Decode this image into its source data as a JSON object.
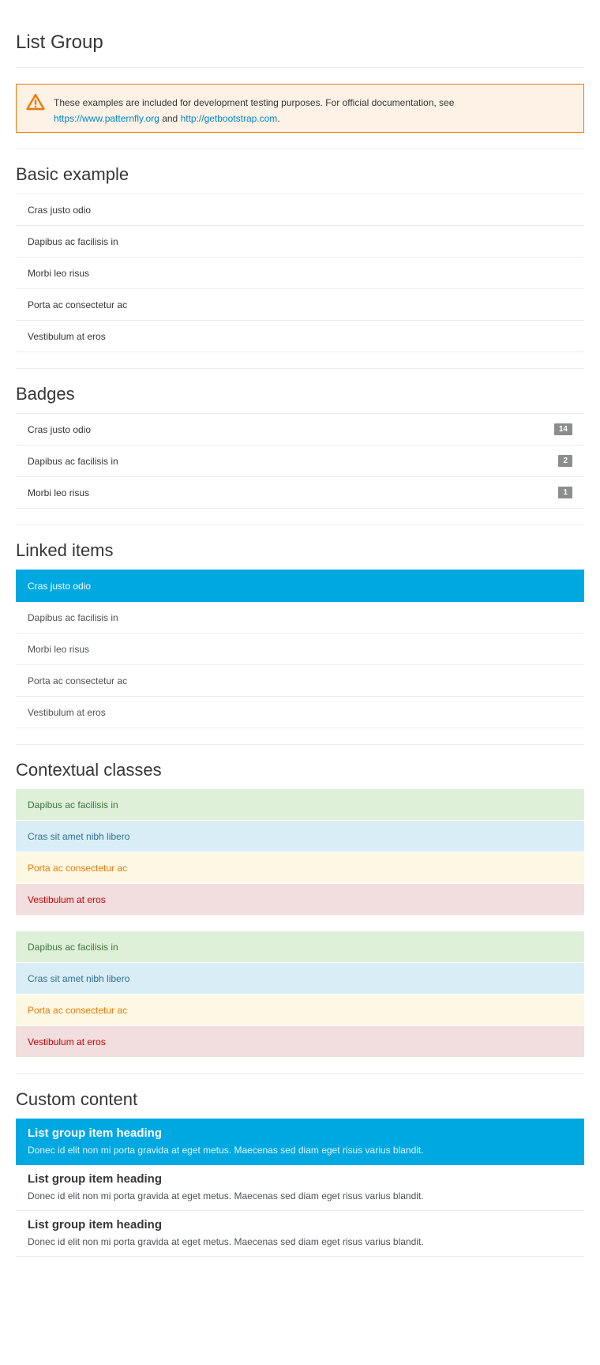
{
  "page": {
    "title": "List Group"
  },
  "alert": {
    "text_before": "These examples are included for development testing purposes. For official documentation, see",
    "link1": "https://www.patternfly.org",
    "text_and": "and",
    "link2": "http://getbootstrap.com",
    "text_end": ".",
    "icon": "warning-triangle-icon",
    "accent_color": "#ec7a08"
  },
  "basic": {
    "title": "Basic example",
    "items": [
      "Cras justo odio",
      "Dapibus ac facilisis in",
      "Morbi leo risus",
      "Porta ac consectetur ac",
      "Vestibulum at eros"
    ]
  },
  "badges": {
    "title": "Badges",
    "items": [
      {
        "label": "Cras justo odio",
        "badge": "14"
      },
      {
        "label": "Dapibus ac facilisis in",
        "badge": "2"
      },
      {
        "label": "Morbi leo risus",
        "badge": "1"
      }
    ]
  },
  "linked": {
    "title": "Linked items",
    "items": [
      "Cras justo odio",
      "Dapibus ac facilisis in",
      "Morbi leo risus",
      "Porta ac consectetur ac",
      "Vestibulum at eros"
    ],
    "active_color": "#00a8e1"
  },
  "contextual": {
    "title": "Contextual classes",
    "group1": [
      "Dapibus ac facilisis in",
      "Cras sit amet nibh libero",
      "Porta ac consectetur ac",
      "Vestibulum at eros"
    ],
    "group2": [
      "Dapibus ac facilisis in",
      "Cras sit amet nibh libero",
      "Porta ac consectetur ac",
      "Vestibulum at eros"
    ],
    "colors": {
      "success": "#dff0d8",
      "info": "#d9edf7",
      "warning": "#fcf8e3",
      "danger": "#f2dede"
    }
  },
  "custom": {
    "title": "Custom content",
    "items": [
      {
        "heading": "List group item heading",
        "text": "Donec id elit non mi porta gravida at eget metus. Maecenas sed diam eget risus varius blandit."
      },
      {
        "heading": "List group item heading",
        "text": "Donec id elit non mi porta gravida at eget metus. Maecenas sed diam eget risus varius blandit."
      },
      {
        "heading": "List group item heading",
        "text": "Donec id elit non mi porta gravida at eget metus. Maecenas sed diam eget risus varius blandit."
      }
    ]
  }
}
